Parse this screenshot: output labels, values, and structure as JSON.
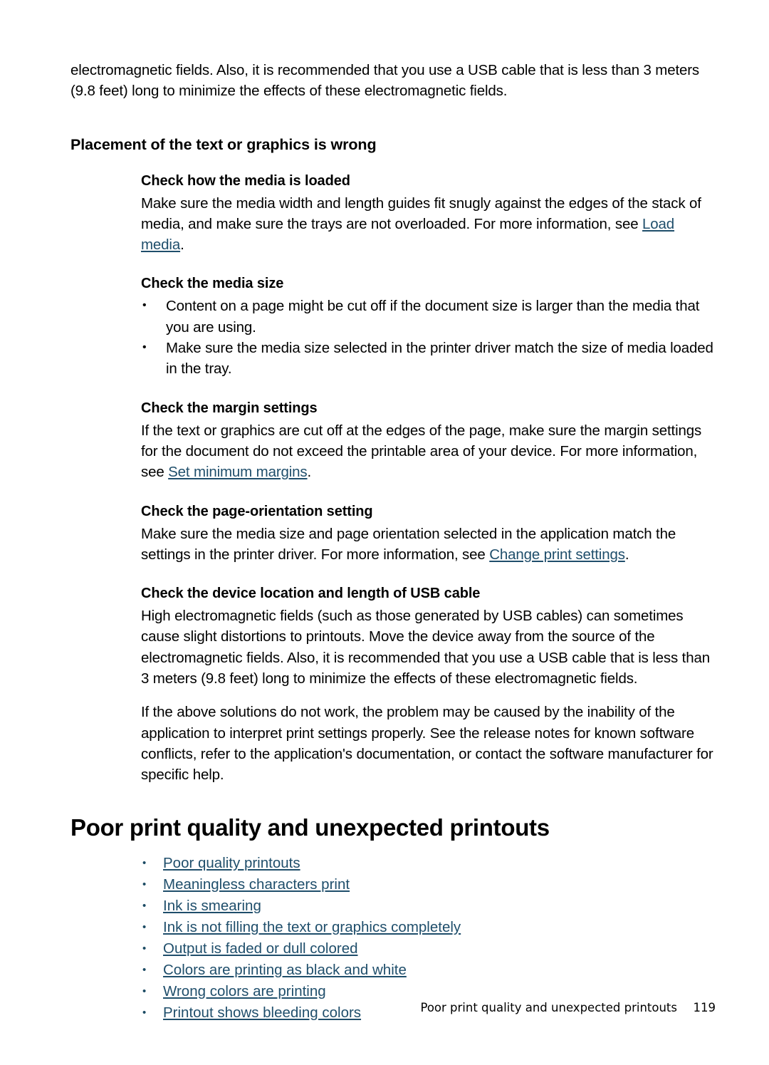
{
  "page": {
    "number": "119",
    "running_footer": "Poor print quality and unexpected printouts"
  },
  "intro_paragraph": "electromagnetic fields. Also, it is recommended that you use a USB cable that is less than 3 meters (9.8 feet) long to minimize the effects of these electromagnetic fields.",
  "placement_section": {
    "title": "Placement of the text or graphics is wrong",
    "subsections": [
      {
        "heading": "Check how the media is loaded",
        "paragraph_before_link": "Make sure the media width and length guides fit snugly against the edges of the stack of media, and make sure the trays are not overloaded. For more information, see ",
        "link": "Load media",
        "paragraph_after_link": "."
      },
      {
        "heading": "Check the media size",
        "bullets": [
          "Content on a page might be cut off if the document size is larger than the media that you are using.",
          "Make sure the media size selected in the printer driver match the size of media loaded in the tray."
        ]
      },
      {
        "heading": "Check the margin settings",
        "paragraph_before_link": "If the text or graphics are cut off at the edges of the page, make sure the margin settings for the document do not exceed the printable area of your device. For more information, see ",
        "link": "Set minimum margins",
        "paragraph_after_link": "."
      },
      {
        "heading": "Check the page-orientation setting",
        "paragraph_before_link": "Make sure the media size and page orientation selected in the application match the settings in the printer driver. For more information, see ",
        "link": "Change print settings",
        "paragraph_after_link": "."
      },
      {
        "heading": "Check the device location and length of USB cable",
        "paragraph": "High electromagnetic fields (such as those generated by USB cables) can sometimes cause slight distortions to printouts. Move the device away from the source of the electromagnetic fields. Also, it is recommended that you use a USB cable that is less than 3 meters (9.8 feet) long to minimize the effects of these electromagnetic fields.",
        "paragraph_2": "If the above solutions do not work, the problem may be caused by the inability of the application to interpret print settings properly. See the release notes for known software conflicts, refer to the application's documentation, or contact the software manufacturer for specific help."
      }
    ]
  },
  "poor_print_section": {
    "title": "Poor print quality and unexpected printouts",
    "links": [
      "Poor quality printouts",
      "Meaningless characters print",
      "Ink is smearing",
      "Ink is not filling the text or graphics completely",
      "Output is faded or dull colored",
      "Colors are printing as black and white",
      "Wrong colors are printing",
      "Printout shows bleeding colors"
    ]
  },
  "colors": {
    "link": "#1f4e6b",
    "text": "#000000",
    "background": "#ffffff"
  }
}
